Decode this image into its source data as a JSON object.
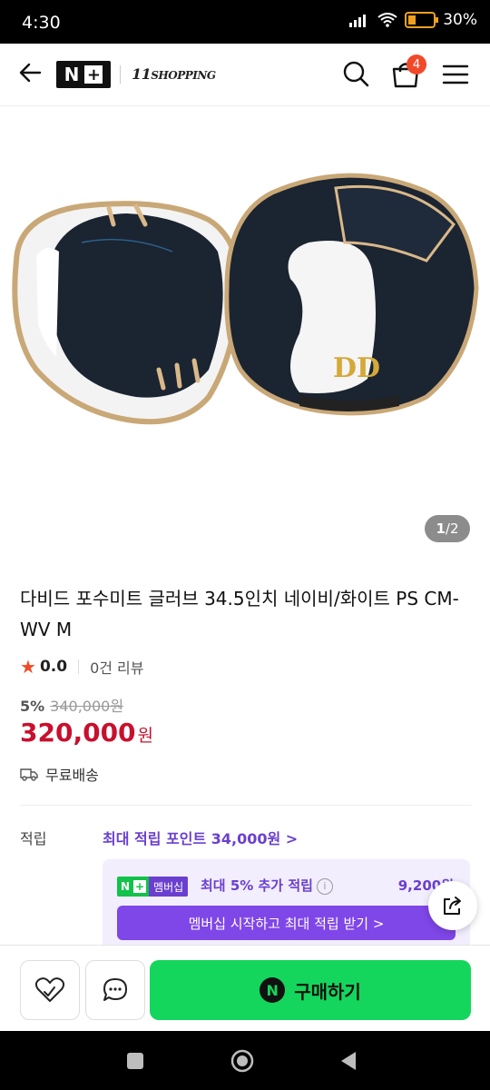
{
  "status": {
    "time": "4:30",
    "battery": "30%",
    "battery_level": 0.3
  },
  "header": {
    "brand": "11 SHOPPING",
    "brand_main": "11",
    "brand_sub": "SHOPPING",
    "nplus_n": "N",
    "nplus_plus": "+",
    "cart_count": "4"
  },
  "gallery": {
    "pager_current": "1",
    "pager_sep": " / ",
    "pager_total": "2"
  },
  "product": {
    "title": "다비드 포수미트 글러브 34.5인치 네이비/화이트 PS CM-WV M",
    "rating": "0.0",
    "reviews": "0건 리뷰",
    "discount": "5%",
    "original_price": "340,000원",
    "price": "320,000",
    "price_unit": "원",
    "shipping": "무료배송"
  },
  "points": {
    "label": "적립",
    "max_points": "최대 적립 포인트 34,000원 >",
    "membership_badge_n": "N",
    "membership_badge_plus": "+",
    "membership_badge_label": "멤버십",
    "membership_text": "최대 5% 추가 적립",
    "membership_info": "i",
    "membership_points": "9,200원",
    "membership_button": "멤버십 시작하고 최대 적립 받기 >"
  },
  "bottom": {
    "buy_icon": "N",
    "buy_label": "구매하기"
  },
  "colors": {
    "price": "#c8102e",
    "accent": "#6a3fd0",
    "buy": "#14d65c",
    "badge": "#f04a2a"
  }
}
